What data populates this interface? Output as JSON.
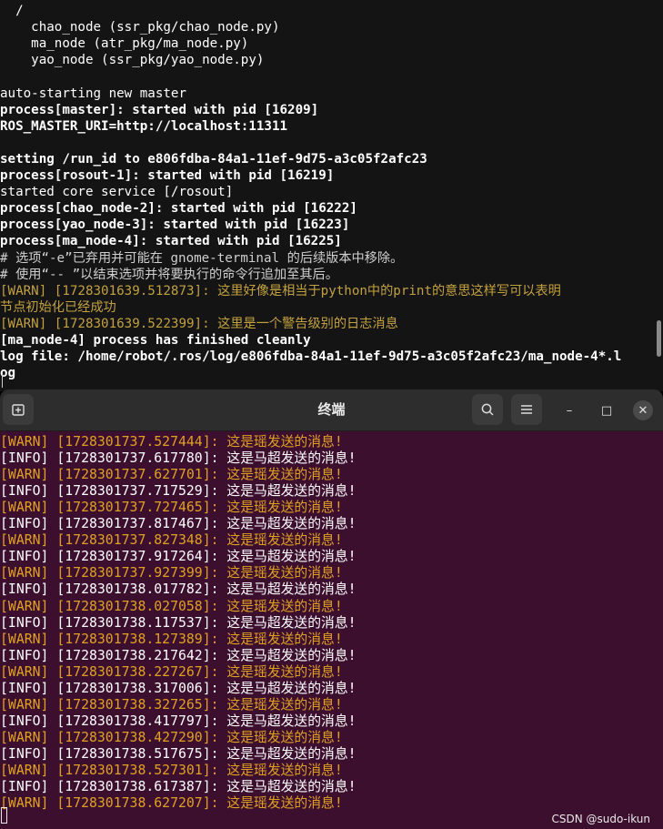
{
  "top_terminal": {
    "lines": [
      {
        "text": "  /",
        "style": "normal"
      },
      {
        "text": "    chao_node (ssr_pkg/chao_node.py)",
        "style": "normal"
      },
      {
        "text": "    ma_node (atr_pkg/ma_node.py)",
        "style": "normal"
      },
      {
        "text": "    yao_node (ssr_pkg/yao_node.py)",
        "style": "normal"
      },
      {
        "text": "",
        "style": "normal"
      },
      {
        "text": "auto-starting new master",
        "style": "normal"
      },
      {
        "text": "process[master]: started with pid [16209]",
        "style": "bold"
      },
      {
        "text": "ROS_MASTER_URI=http://localhost:11311",
        "style": "bold"
      },
      {
        "text": "",
        "style": "normal"
      },
      {
        "text": "setting /run_id to e806fdba-84a1-11ef-9d75-a3c05f2afc23",
        "style": "bold"
      },
      {
        "text": "process[rosout-1]: started with pid [16219]",
        "style": "bold"
      },
      {
        "text": "started core service [/rosout]",
        "style": "normal"
      },
      {
        "text": "process[chao_node-2]: started with pid [16222]",
        "style": "bold"
      },
      {
        "text": "process[yao_node-3]: started with pid [16223]",
        "style": "bold"
      },
      {
        "text": "process[ma_node-4]: started with pid [16225]",
        "style": "bold"
      },
      {
        "text": "# 选项“-e”已弃用并可能在 gnome-terminal 的后续版本中移除。",
        "style": "comment"
      },
      {
        "text": "# 使用“-- ”以结束选项并将要执行的命令行追加至其后。",
        "style": "comment"
      },
      {
        "text": "[WARN] [1728301639.512873]: 这里好像是相当于python中的print的意思这样写可以表明",
        "style": "warn"
      },
      {
        "text": "节点初始化已经成功",
        "style": "warn"
      },
      {
        "text": "[WARN] [1728301639.522399]: 这里是一个警告级别的日志消息",
        "style": "warn"
      },
      {
        "text": "[ma_node-4] process has finished cleanly",
        "style": "bold"
      },
      {
        "text": "log file: /home/robot/.ros/log/e806fdba-84a1-11ef-9d75-a3c05f2afc23/ma_node-4*.l",
        "style": "bold"
      },
      {
        "text": "og",
        "style": "bold"
      }
    ]
  },
  "titlebar": {
    "title": "终端",
    "new_tab_icon": "new-tab-icon",
    "search_icon": "search-icon",
    "menu_icon": "hamburger-menu-icon",
    "minimize_label": "–",
    "maximize_label": "□",
    "close_label": "✕"
  },
  "bottom_terminal": {
    "lines": [
      {
        "level": "WARN",
        "text": "[WARN] [1728301737.527444]: 这是瑶发送的消息!"
      },
      {
        "level": "INFO",
        "text": "[INFO] [1728301737.617780]: 这是马超发送的消息!"
      },
      {
        "level": "WARN",
        "text": "[WARN] [1728301737.627701]: 这是瑶发送的消息!"
      },
      {
        "level": "INFO",
        "text": "[INFO] [1728301737.717529]: 这是马超发送的消息!"
      },
      {
        "level": "WARN",
        "text": "[WARN] [1728301737.727465]: 这是瑶发送的消息!"
      },
      {
        "level": "INFO",
        "text": "[INFO] [1728301737.817467]: 这是马超发送的消息!"
      },
      {
        "level": "WARN",
        "text": "[WARN] [1728301737.827348]: 这是瑶发送的消息!"
      },
      {
        "level": "INFO",
        "text": "[INFO] [1728301737.917264]: 这是马超发送的消息!"
      },
      {
        "level": "WARN",
        "text": "[WARN] [1728301737.927399]: 这是瑶发送的消息!"
      },
      {
        "level": "INFO",
        "text": "[INFO] [1728301738.017782]: 这是马超发送的消息!"
      },
      {
        "level": "WARN",
        "text": "[WARN] [1728301738.027058]: 这是瑶发送的消息!"
      },
      {
        "level": "INFO",
        "text": "[INFO] [1728301738.117537]: 这是马超发送的消息!"
      },
      {
        "level": "WARN",
        "text": "[WARN] [1728301738.127389]: 这是瑶发送的消息!"
      },
      {
        "level": "INFO",
        "text": "[INFO] [1728301738.217642]: 这是马超发送的消息!"
      },
      {
        "level": "WARN",
        "text": "[WARN] [1728301738.227267]: 这是瑶发送的消息!"
      },
      {
        "level": "INFO",
        "text": "[INFO] [1728301738.317006]: 这是马超发送的消息!"
      },
      {
        "level": "WARN",
        "text": "[WARN] [1728301738.327265]: 这是瑶发送的消息!"
      },
      {
        "level": "INFO",
        "text": "[INFO] [1728301738.417797]: 这是马超发送的消息!"
      },
      {
        "level": "WARN",
        "text": "[WARN] [1728301738.427290]: 这是瑶发送的消息!"
      },
      {
        "level": "INFO",
        "text": "[INFO] [1728301738.517675]: 这是马超发送的消息!"
      },
      {
        "level": "WARN",
        "text": "[WARN] [1728301738.527301]: 这是瑶发送的消息!"
      },
      {
        "level": "INFO",
        "text": "[INFO] [1728301738.617387]: 这是马超发送的消息!"
      },
      {
        "level": "WARN",
        "text": "[WARN] [1728301738.627207]: 这是瑶发送的消息!"
      }
    ]
  },
  "watermark": "CSDN @sudo-ikun",
  "colors": {
    "top_background": "#141414",
    "bottom_background": "#3d0f2e",
    "warn_top": "#c3a13e",
    "warn_bottom": "#e0a123",
    "info": "#ffffff"
  }
}
